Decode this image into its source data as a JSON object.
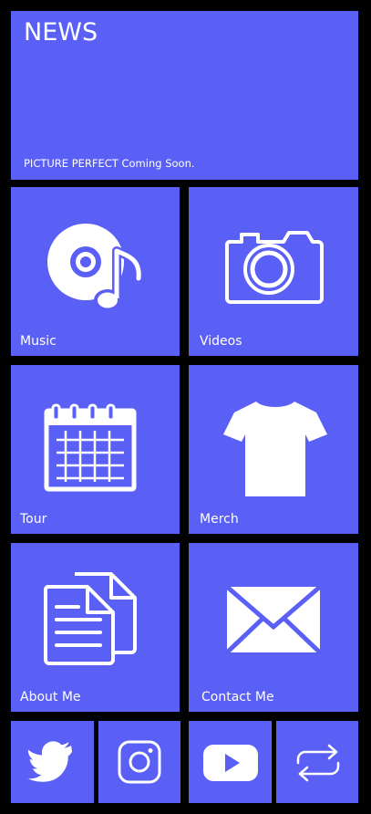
{
  "news": {
    "title": "NEWS",
    "subtitle": "PICTURE PERFECT Coming Soon."
  },
  "tiles": {
    "music": {
      "label": "Music",
      "icon": "music-disc-icon"
    },
    "videos": {
      "label": "Videos",
      "icon": "camera-icon"
    },
    "tour": {
      "label": "Tour",
      "icon": "calendar-icon"
    },
    "merch": {
      "label": "Merch",
      "icon": "tshirt-icon"
    },
    "about": {
      "label": "About Me",
      "icon": "documents-icon"
    },
    "contact": {
      "label": "Contact Me",
      "icon": "envelope-icon"
    }
  },
  "social": [
    {
      "icon": "twitter-icon"
    },
    {
      "icon": "instagram-icon"
    },
    {
      "icon": "youtube-icon"
    },
    {
      "icon": "repeat-icon"
    }
  ],
  "colors": {
    "tile": "#5a5ff5",
    "background": "#000000",
    "text": "#ffffff"
  }
}
